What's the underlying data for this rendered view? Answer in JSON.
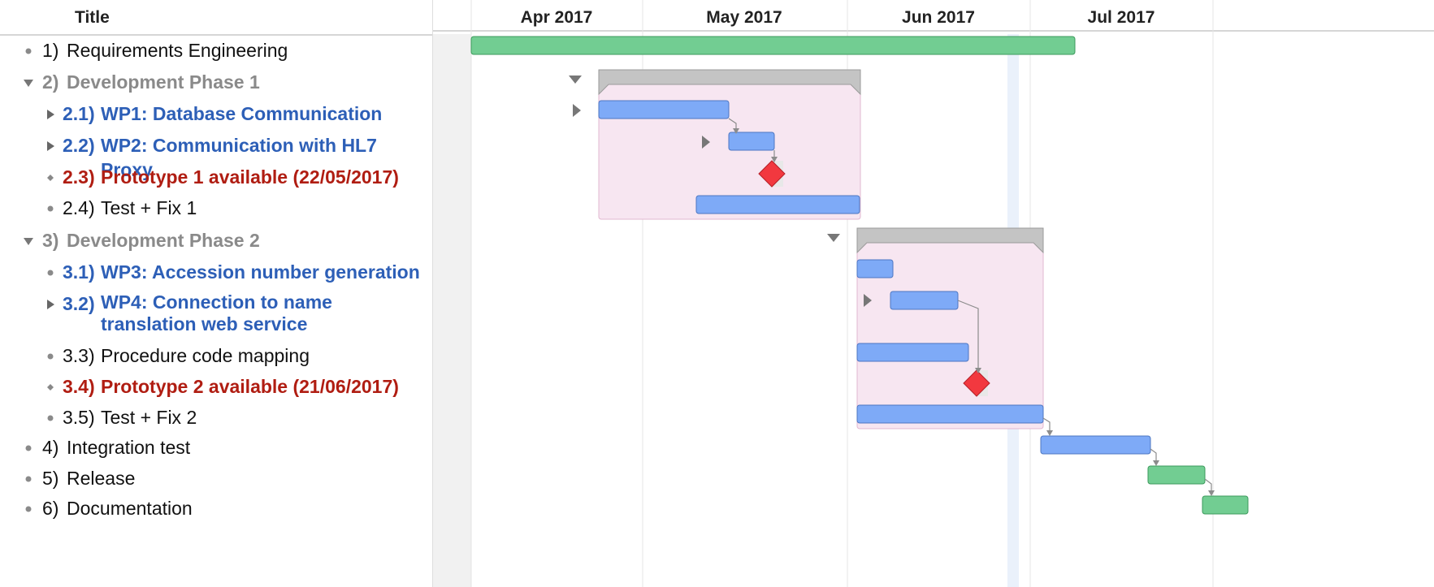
{
  "outline": {
    "header_title": "Title",
    "rows": [
      {
        "num": "1)",
        "title": "Requirements Engineering",
        "style": "plain",
        "control": "bullet"
      },
      {
        "num": "2)",
        "title": "Development Phase 1",
        "style": "group",
        "control": "expanded"
      },
      {
        "num": "2.1)",
        "title": "WP1: Database Communication",
        "style": "blue",
        "control": "collapsed"
      },
      {
        "num": "2.2)",
        "title": "WP2: Communication with HL7 Proxy",
        "style": "blue",
        "control": "collapsed"
      },
      {
        "num": "2.3)",
        "title": "Prototype 1 available (22/05/2017)",
        "style": "red",
        "control": "diamond"
      },
      {
        "num": "2.4)",
        "title": "Test + Fix 1",
        "style": "plain",
        "control": "bullet"
      },
      {
        "num": "3)",
        "title": "Development Phase 2",
        "style": "group",
        "control": "expanded"
      },
      {
        "num": "3.1)",
        "title": "WP3: Accession number generation",
        "style": "blue",
        "control": "bullet"
      },
      {
        "num": "3.2)",
        "title": "WP4: Connection to name translation web service",
        "style": "blue",
        "control": "collapsed"
      },
      {
        "num": "3.3)",
        "title": "Procedure code mapping",
        "style": "plain",
        "control": "bullet"
      },
      {
        "num": "3.4)",
        "title": "Prototype 2 available (21/06/2017)",
        "style": "red",
        "control": "diamond"
      },
      {
        "num": "3.5)",
        "title": "Test + Fix 2",
        "style": "plain",
        "control": "bullet"
      },
      {
        "num": "4)",
        "title": "Integration test",
        "style": "plain",
        "control": "bullet"
      },
      {
        "num": "5)",
        "title": "Release",
        "style": "plain",
        "control": "bullet"
      },
      {
        "num": "6)",
        "title": "Documentation",
        "style": "plain",
        "control": "bullet"
      }
    ]
  },
  "timeline": {
    "months": [
      "Apr 2017",
      "May 2017",
      "Jun 2017",
      "Jul 2017"
    ]
  },
  "colors": {
    "task_bar": "#7eaaf7",
    "task_bar_border": "#4d77c2",
    "milestone_bar": "#72cd92",
    "milestone_bar_border": "#3c9a5c",
    "group_bracket": "#c4c4c4",
    "group_region": "#f7e6f1",
    "group_region_border": "#e2b8d1",
    "milestone_diamond": "#f2383f",
    "text_blue": "#2d5fb7",
    "text_red": "#b01d12",
    "text_grey": "#8a8a8a"
  },
  "icons": {
    "expanded": "triangle-down-icon",
    "collapsed": "triangle-right-icon",
    "bullet": "bullet-icon",
    "milestone": "diamond-icon"
  }
}
